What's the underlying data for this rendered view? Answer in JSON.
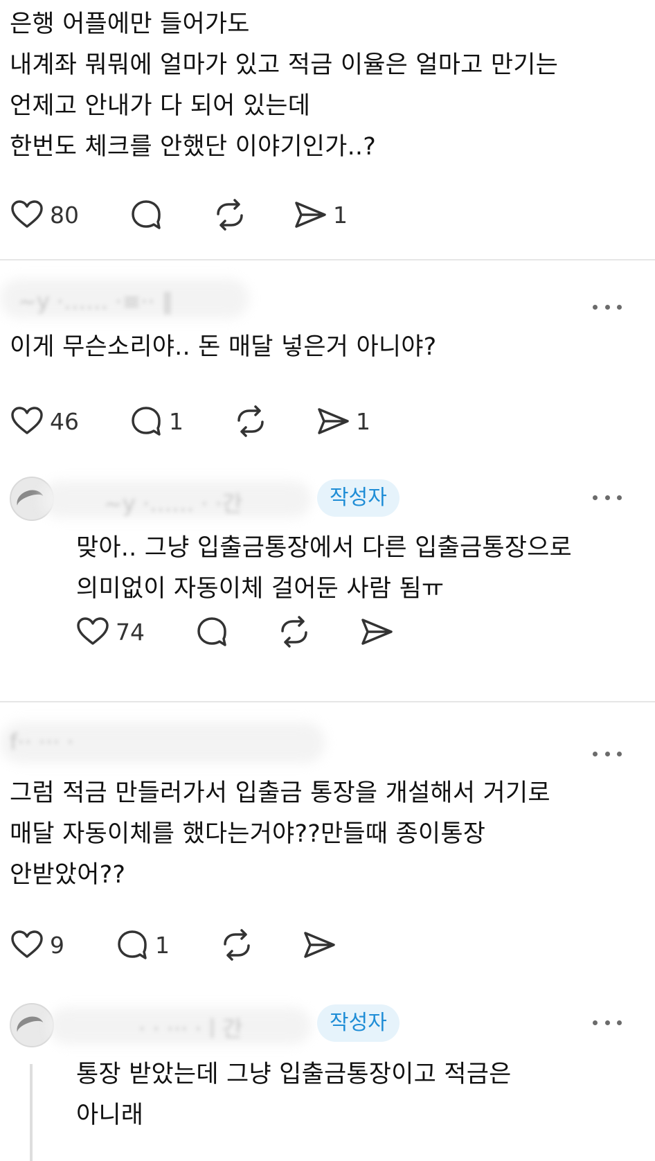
{
  "posts": [
    {
      "lines": [
        "은행 어플에만 들어가도",
        "내계좌 뭐뭐에 얼마가 있고 적금 이율은 얼마고 만기는",
        "언제고 안내가 다 되어 있는데",
        "한번도 체크를 안했단 이야기인가..?"
      ],
      "likes": "80",
      "comments": "",
      "shares": "1"
    },
    {
      "lines": [
        "이게 무슨소리야.. 돈 매달 넣은거 아니야?"
      ],
      "likes": "46",
      "comments": "1",
      "shares": "1"
    },
    {
      "badge": "작성자",
      "lines": [
        "맞아.. 그냥 입출금통장에서 다른 입출금통장으로",
        "의미없이 자동이체 걸어둔 사람 됨ㅠ"
      ],
      "likes": "74",
      "comments": "",
      "shares": ""
    },
    {
      "lines": [
        "그럼 적금 만들러가서 입출금 통장을 개설해서 거기로",
        "매달 자동이체를 했다는거야??만들때 종이통장",
        "안받았어??"
      ],
      "likes": "9",
      "comments": "1",
      "shares": ""
    },
    {
      "badge": "작성자",
      "lines": [
        "통장 받았는데 그냥 입출금통장이고 적금은",
        "아니래"
      ]
    }
  ],
  "icons": {
    "like": "heart-icon",
    "comment": "comment-bubble-icon",
    "repost": "repost-icon",
    "share": "send-icon",
    "more": "more-dots-icon"
  }
}
